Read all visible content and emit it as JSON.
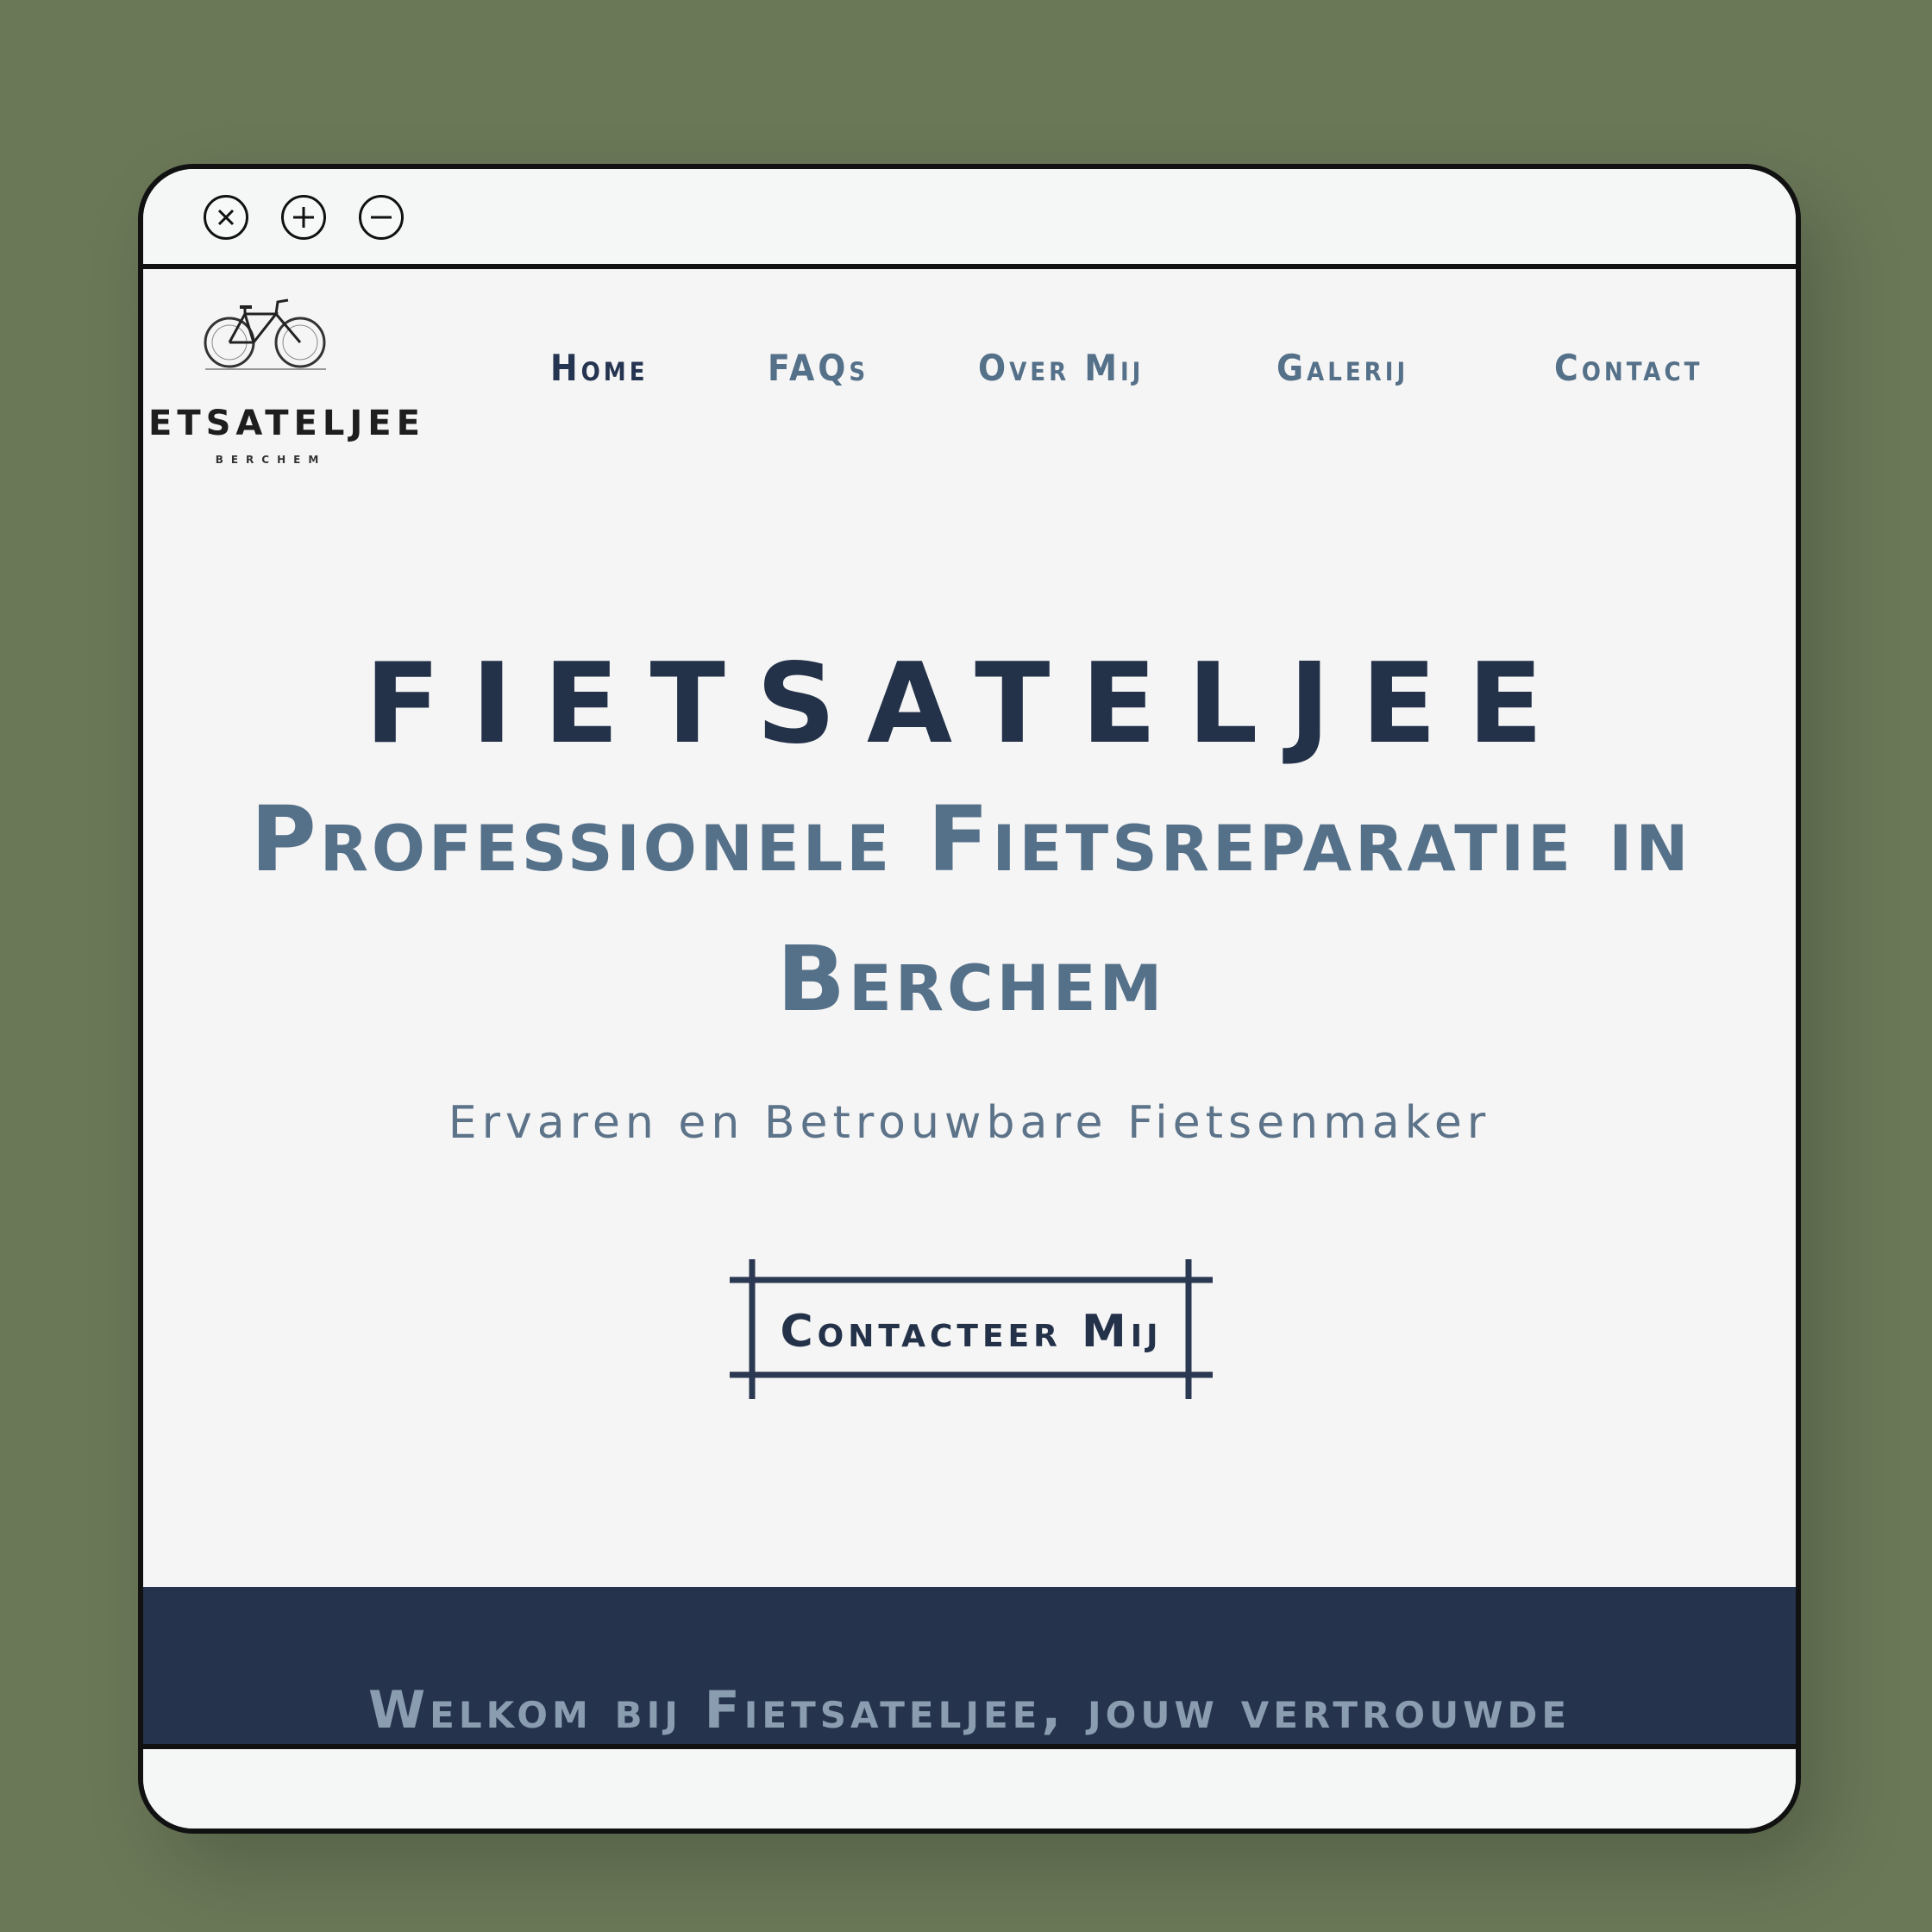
{
  "window": {
    "controls": [
      "close-icon",
      "plus-icon",
      "minus-icon"
    ]
  },
  "logo": {
    "text": "ETSATELJEE",
    "subtext": "BERCHEM",
    "icon": "bicycle-icon"
  },
  "nav": {
    "items": [
      {
        "label": "Home"
      },
      {
        "label": "FAQs"
      },
      {
        "label": "Over Mij"
      },
      {
        "label": "Galerij"
      },
      {
        "label": "Contact"
      }
    ]
  },
  "hero": {
    "title": "FIETSATELJEE",
    "subtitle": "Professionele Fietsreparatie in Berchem",
    "tagline": "Ervaren en Betrouwbare Fietsenmaker",
    "cta_label": "Contacteer Mij"
  },
  "welcome": {
    "heading": "Welkom bij Fietsateljee, jouw vertrouwde"
  },
  "colors": {
    "background": "#6a7858",
    "page": "#f5f5f5",
    "navy": "#233149",
    "slate_blue": "#557089",
    "band": "#25334c"
  }
}
